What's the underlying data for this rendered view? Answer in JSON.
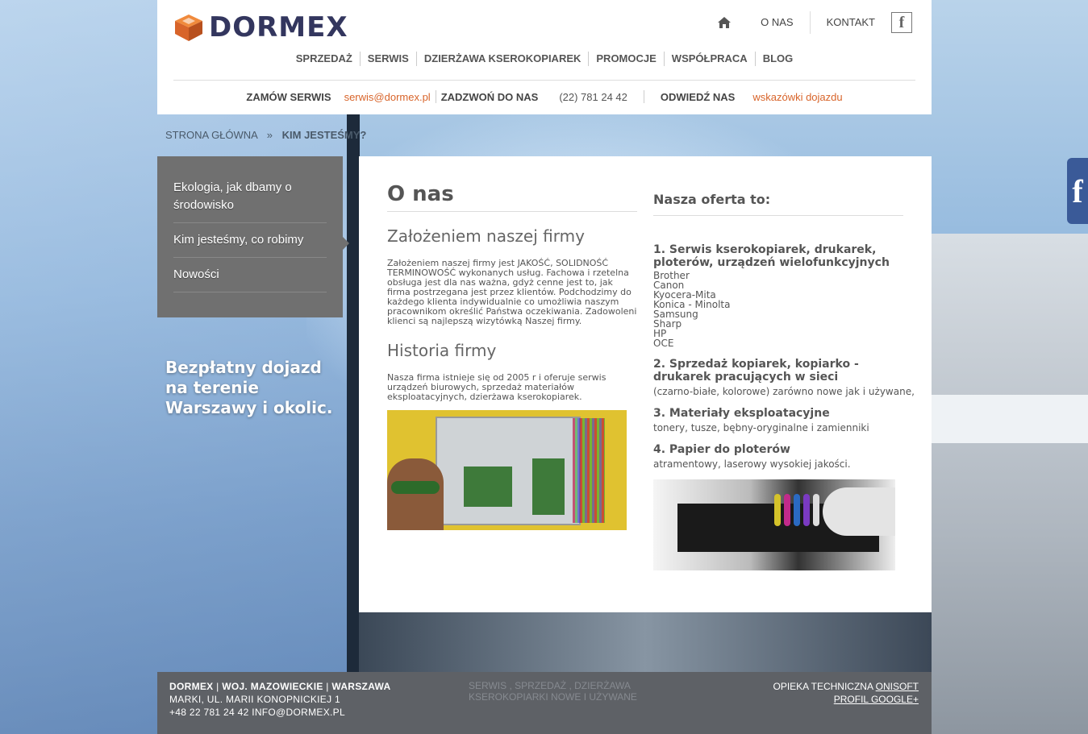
{
  "brand": {
    "name": "DORMEX"
  },
  "topnav": {
    "about": "O NAS",
    "contact": "KONTAKT",
    "facebook": "f"
  },
  "mainnav": [
    "SPRZEDAŻ",
    "SERWIS",
    "DZIERŻAWA KSEROKOPIAREK",
    "PROMOCJE",
    "WSPÓŁPRACA",
    "BLOG"
  ],
  "contactbar": {
    "order_label": "ZAMÓW SERWIS",
    "email": "serwis@dormex.pl",
    "call_label": "ZADZWOŃ DO NAS",
    "phone": "(22) 781 24 42",
    "visit_label": "ODWIEDŹ NAS",
    "directions": "wskazówki dojazdu"
  },
  "breadcrumb": {
    "home": "STRONA GŁÓWNA",
    "sep": "»",
    "current": "KIM JESTEŚMY?"
  },
  "sidemenu": [
    "Ekologia, jak dbamy o środowisko",
    "Kim jesteśmy, co robimy",
    "Nowości"
  ],
  "promo": "Bezpłatny dojazd na terenie Warszawy i okolic.",
  "left": {
    "title": "O nas",
    "sub1": "Założeniem naszej firmy",
    "text1": "Założeniem naszej firmy jest JAKOŚĆ, SOLIDNOŚĆ TERMINOWOŚĆ wykonanych usług. Fachowa i rzetelna obsługa jest dla nas ważna, gdyż cenne jest to, jak firma postrzegana jest przez klientów. Podchodzimy do każdego klienta indywidualnie co umożliwia naszym pracownikom określić Państwa oczekiwania. Zadowoleni klienci są najlepszą wizytówką Naszej firmy.",
    "sub2": "Historia firmy",
    "text2": "Nasza firma istnieje się od 2005 r i oferuje serwis urządzeń biurowych, sprzedaż materiałów eksploatacyjnych, dzierżawa kserokopiarek."
  },
  "right": {
    "title": "Nasza oferta to:",
    "s1_title": "1. Serwis kserokopiarek, drukarek, ploterów, urządzeń wielofunkcyjnych",
    "brands": [
      "Brother",
      "Canon",
      "Kyocera-Mita",
      "Konica - Minolta",
      "Samsung",
      "Sharp",
      "HP",
      "OCE"
    ],
    "s2_title": "2. Sprzedaż kopiarek, kopiarko - drukarek pracujących w sieci",
    "s2_desc": "(czarno-białe, kolorowe) zarówno nowe jak i używane,",
    "s3_title": "3. Materiały eksploatacyjne",
    "s3_desc": "tonery, tusze, bębny-oryginalne i zamienniki",
    "s4_title": "4. Papier do ploterów",
    "s4_desc": "atramentowy, laserowy wysokiej jakości."
  },
  "footer": {
    "company": "DORMEX",
    "region": "WOJ. MAZOWIECKIE",
    "city": "WARSZAWA",
    "address": "MARKI, UL. MARII KONOPNICKIEJ 1",
    "contact": "+48 22 781 24 42 INFO@DORMEX.PL",
    "mid1": "SERWIS , SPRZEDAŻ , DZIERŻAWA",
    "mid2": "KSEROKOPIARKI NOWE I UŻYWANE",
    "care_label": "OPIEKA TECHNICZNA",
    "care_link": "ONISOFT",
    "google": "PROFIL GOOGLE+"
  },
  "colors": {
    "accent": "#d8642a",
    "brand_dark": "#33365e",
    "sidebar": "#707070",
    "footer": "#5e6166",
    "facebook": "#3a5a98"
  }
}
